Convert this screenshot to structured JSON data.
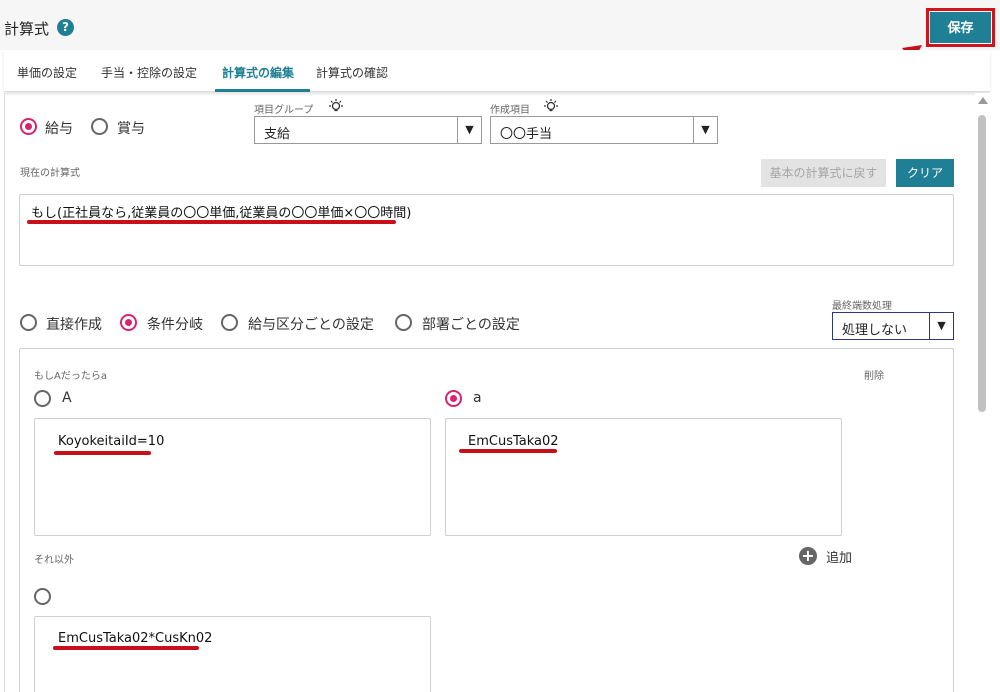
{
  "header": {
    "title": "計算式",
    "help_icon": "?",
    "save_label": "保存"
  },
  "tabs": [
    {
      "label": "単価の設定",
      "active": false
    },
    {
      "label": "手当・控除の設定",
      "active": false
    },
    {
      "label": "計算式の編集",
      "active": true
    },
    {
      "label": "計算式の確認",
      "active": false
    }
  ],
  "pay_type": {
    "options": [
      "給与",
      "賞与"
    ],
    "selected": "給与"
  },
  "item_group": {
    "label": "項目グループ",
    "value": "支給",
    "arrow": "▼"
  },
  "creation_item": {
    "label": "作成項目",
    "value": "〇〇手当",
    "arrow": "▼"
  },
  "current_formula": {
    "label": "現在の計算式",
    "reset_label": "基本の計算式に戻す",
    "clear_label": "クリア",
    "text": "もし(正社員なら,従業員の〇〇単価,従業員の〇〇単価×〇〇時間)"
  },
  "mode": {
    "options": [
      "直接作成",
      "条件分岐",
      "給与区分ごとの設定",
      "部署ごとの設定"
    ],
    "selected": "条件分岐"
  },
  "rounding": {
    "label": "最終端数処理",
    "value": "処理しない",
    "arrow": "▼"
  },
  "condition": {
    "label": "もしAだったらa",
    "delete_label": "削除",
    "option_a": "A",
    "option_b": "a",
    "selected": "a",
    "a_text": "KoyokeitaiId=10",
    "b_text": "EmCusTaka02"
  },
  "else_section": {
    "label": "それ以外",
    "add_label": "追加",
    "add_icon": "+",
    "text": "EmCusTaka02*CusKn02"
  },
  "colors": {
    "accent": "#1f7f94",
    "radio_selected": "#d6246e",
    "annotation_red": "#c8101a"
  }
}
